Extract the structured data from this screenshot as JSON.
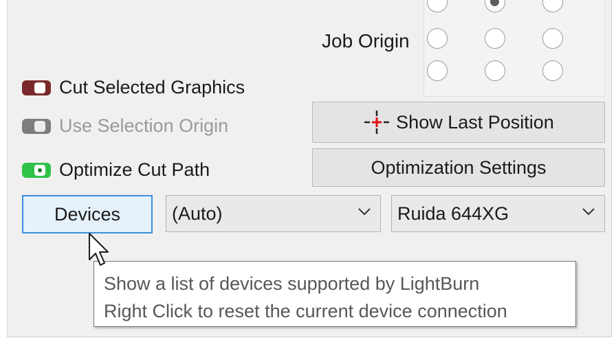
{
  "job_origin": {
    "label": "Job Origin",
    "selected": "top-center"
  },
  "options": [
    {
      "label": "Cut Selected Graphics",
      "state": "on",
      "color": "#7a2a2a",
      "enabled": true
    },
    {
      "label": "Use Selection Origin",
      "state": "off",
      "color": "#7d7d7d",
      "enabled": false
    },
    {
      "label": "Optimize Cut Path",
      "state": "on",
      "color": "#2fc24a",
      "enabled": true
    }
  ],
  "buttons": {
    "show_last_position": "Show Last Position",
    "optimization_settings": "Optimization Settings",
    "devices": "Devices"
  },
  "selects": {
    "port": {
      "value": "(Auto)"
    },
    "device": {
      "value": "Ruida 644XG"
    }
  },
  "tooltip": {
    "line1": "Show a list of devices supported by LightBurn",
    "line2": "Right Click to reset the current device connection"
  },
  "icons": {
    "position_marker": "crosshair-icon",
    "dropdown": "chevron-down-icon",
    "pointer": "mouse-cursor-icon"
  }
}
